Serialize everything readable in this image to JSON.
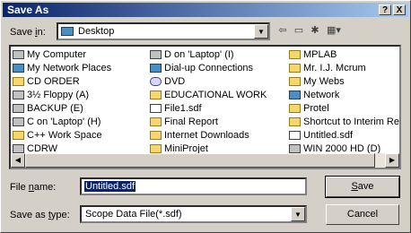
{
  "window": {
    "title": "Save As",
    "help_label": "?",
    "close_label": "X"
  },
  "save_in": {
    "label_pre": "Save ",
    "label_key": "i",
    "label_post": "n:",
    "value": "Desktop"
  },
  "toolbar": {
    "back_icon": "back-arrow-icon",
    "up_icon": "up-folder-icon",
    "new_folder_icon": "new-folder-icon",
    "views_icon": "views-menu-icon"
  },
  "files": {
    "col1": [
      {
        "name": "My Computer",
        "icon": "drive"
      },
      {
        "name": "My Network Places",
        "icon": "net"
      },
      {
        "name": "CD ORDER",
        "icon": "folder"
      },
      {
        "name": "3½ Floppy (A)",
        "icon": "drive"
      },
      {
        "name": "BACKUP (E)",
        "icon": "drive"
      },
      {
        "name": "C on 'Laptop' (H)",
        "icon": "drive"
      },
      {
        "name": "C++ Work Space",
        "icon": "folder"
      },
      {
        "name": "CDRW",
        "icon": "drive"
      }
    ],
    "col2": [
      {
        "name": "D on 'Laptop' (I)",
        "icon": "drive"
      },
      {
        "name": "Dial-up Connections",
        "icon": "net"
      },
      {
        "name": "DVD",
        "icon": "dvd"
      },
      {
        "name": "EDUCATIONAL WORK",
        "icon": "folder"
      },
      {
        "name": "File1.sdf",
        "icon": "file"
      },
      {
        "name": "Final Report",
        "icon": "folder"
      },
      {
        "name": "Internet Downloads",
        "icon": "folder"
      },
      {
        "name": "MiniProjet",
        "icon": "folder"
      }
    ],
    "col3": [
      {
        "name": "MPLAB",
        "icon": "folder"
      },
      {
        "name": "Mr. I.J. Mcrum",
        "icon": "folder"
      },
      {
        "name": "My Webs",
        "icon": "folder"
      },
      {
        "name": "Network",
        "icon": "net"
      },
      {
        "name": "Protel",
        "icon": "folder"
      },
      {
        "name": "Shortcut to Interim Re",
        "icon": "folder"
      },
      {
        "name": "Untitled.sdf",
        "icon": "file"
      },
      {
        "name": "WIN 2000 HD (D)",
        "icon": "drive"
      }
    ]
  },
  "file_name": {
    "label_pre": "File ",
    "label_key": "n",
    "label_post": "ame:",
    "value": "Untitled.sdf"
  },
  "save_as_type": {
    "label_pre": "Save as ",
    "label_key": "t",
    "label_post": "ype:",
    "value": "Scope Data File(*.sdf)"
  },
  "buttons": {
    "save_key": "S",
    "save_rest": "ave",
    "cancel": "Cancel"
  }
}
